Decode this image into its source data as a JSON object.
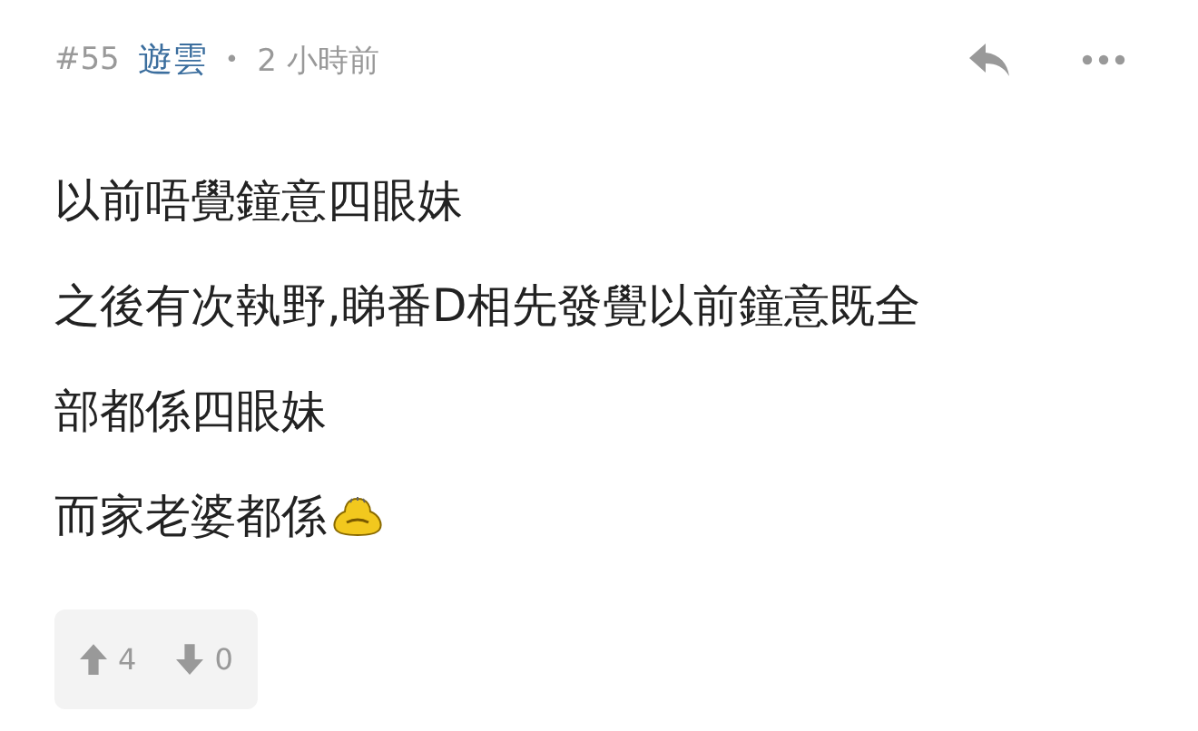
{
  "post": {
    "number": "#55",
    "author": "遊雲",
    "separator": "•",
    "time": "2 小時前",
    "lines": [
      "以前唔覺鐘意四眼妹",
      "之後有次執野,睇番D相先發覺以前鐘意既全",
      "部都係四眼妹",
      "而家老婆都係"
    ],
    "votes": {
      "up": "4",
      "down": "0"
    }
  }
}
